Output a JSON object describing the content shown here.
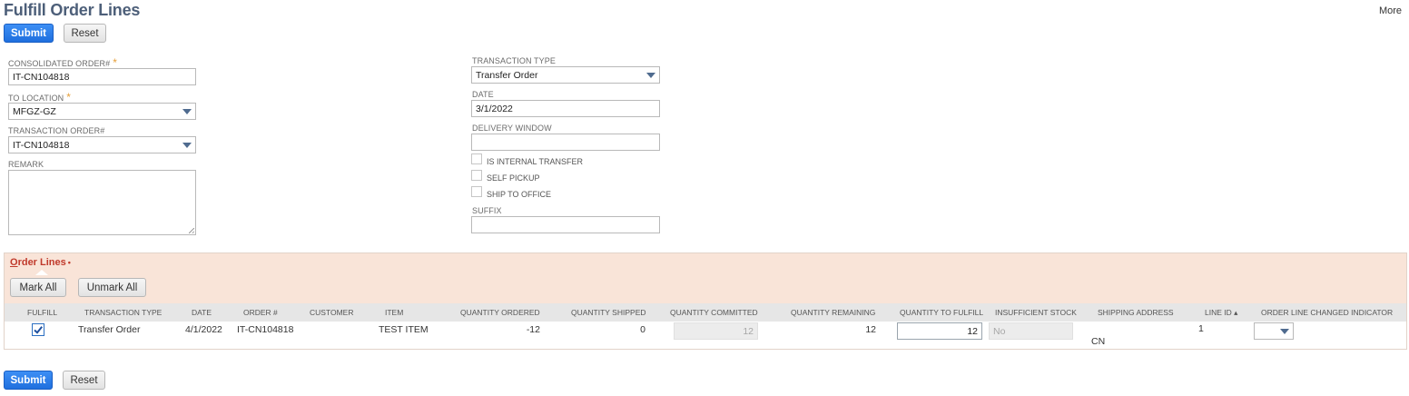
{
  "page": {
    "title": "Fulfill Order Lines",
    "more_label": "More"
  },
  "top_buttons": {
    "submit": "Submit",
    "reset": "Reset"
  },
  "bottom_buttons": {
    "submit": "Submit",
    "reset": "Reset"
  },
  "form_left": {
    "consolidated_order": {
      "label": "CONSOLIDATED ORDER#",
      "required": "*",
      "value": "IT-CN104818"
    },
    "to_location": {
      "label": "TO LOCATION",
      "required": "*",
      "value": "MFGZ-GZ"
    },
    "transaction_order": {
      "label": "TRANSACTION ORDER#",
      "value": "IT-CN104818"
    },
    "remark": {
      "label": "REMARK",
      "value": ""
    }
  },
  "form_right": {
    "transaction_type": {
      "label": "TRANSACTION TYPE",
      "value": "Transfer Order"
    },
    "date": {
      "label": "DATE",
      "value": "3/1/2022"
    },
    "delivery_window": {
      "label": "DELIVERY WINDOW",
      "value": ""
    },
    "is_internal_transfer": {
      "label": "IS INTERNAL TRANSFER",
      "checked": false
    },
    "self_pickup": {
      "label": "SELF PICKUP",
      "checked": false
    },
    "ship_to_office": {
      "label": "SHIP TO OFFICE",
      "checked": false
    },
    "suffix": {
      "label": "SUFFIX",
      "value": ""
    }
  },
  "order_lines": {
    "tab_title_first": "O",
    "tab_title_rest": "rder Lines",
    "tab_marker": "•",
    "mark_all": "Mark All",
    "unmark_all": "Unmark All",
    "columns": {
      "fulfill": "FULFILL",
      "transaction_type": "TRANSACTION TYPE",
      "date": "DATE",
      "order_no": "ORDER #",
      "customer": "CUSTOMER",
      "item": "ITEM",
      "qty_ordered": "QUANTITY ORDERED",
      "qty_shipped": "QUANTITY SHIPPED",
      "qty_committed": "QUANTITY COMMITTED",
      "qty_remaining": "QUANTITY REMAINING",
      "qty_to_fulfill": "QUANTITY TO FULFILL",
      "insufficient_stock": "INSUFFICIENT STOCK",
      "shipping_address": "SHIPPING ADDRESS",
      "line_id": "LINE ID ▴",
      "changed_indicator": "ORDER LINE CHANGED INDICATOR"
    },
    "rows": [
      {
        "fulfill": true,
        "transaction_type": "Transfer Order",
        "date": "4/1/2022",
        "order_no": "IT-CN104818",
        "customer": "",
        "item": "TEST ITEM",
        "qty_ordered": "-12",
        "qty_shipped": "0",
        "qty_committed": "12",
        "qty_remaining": "12",
        "qty_to_fulfill": "12",
        "insufficient_stock": "No",
        "shipping_address": "CN",
        "line_id": "1",
        "changed_indicator": ""
      }
    ]
  },
  "colors": {
    "primary_button": "#1f6fde",
    "title": "#4d5f79",
    "sublist_header_bg": "#f9e4d8",
    "tab_title": "#c0392b",
    "required_marker": "#e6a03a"
  }
}
